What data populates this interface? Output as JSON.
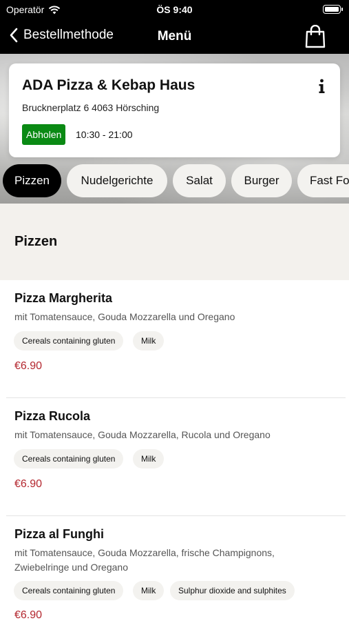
{
  "status_bar": {
    "carrier": "Operatör",
    "time": "ÖS 9:40"
  },
  "nav": {
    "back_label": "Bestellmethode",
    "title": "Menü",
    "cart_icon": "shopping-bag-icon"
  },
  "restaurant": {
    "name": "ADA Pizza & Kebap Haus",
    "address": "Brucknerplatz 6 4063 Hörsching",
    "method_badge": "Abholen",
    "hours": "10:30 - 21:00",
    "badge_color": "#0a8a14"
  },
  "categories": [
    {
      "label": "Pizzen",
      "active": true
    },
    {
      "label": "Nudelgerichte",
      "active": false
    },
    {
      "label": "Salat",
      "active": false
    },
    {
      "label": "Burger",
      "active": false
    },
    {
      "label": "Fast Fo",
      "active": false
    }
  ],
  "section": {
    "title": "Pizzen"
  },
  "items": [
    {
      "name": "Pizza Margherita",
      "description": "mit Tomatensauce, Gouda Mozzarella und Oregano",
      "allergens": [
        "Cereals containing gluten",
        "Milk"
      ],
      "price": "€6.90"
    },
    {
      "name": "Pizza Rucola",
      "description": "mit Tomatensauce, Gouda Mozzarella, Rucola und Oregano",
      "allergens": [
        "Cereals containing gluten",
        "Milk"
      ],
      "price": "€6.90"
    },
    {
      "name": "Pizza al Funghi",
      "description": "mit Tomatensauce, Gouda Mozzarella, frische Champignons, Zwiebelringe und Oregano",
      "allergens": [
        "Cereals containing gluten",
        "Milk",
        "Sulphur dioxide and sulphites"
      ],
      "price": "€6.90"
    }
  ],
  "colors": {
    "price": "#b3262e",
    "active_tab": "#000000",
    "section_bg": "#f3f1ed"
  }
}
